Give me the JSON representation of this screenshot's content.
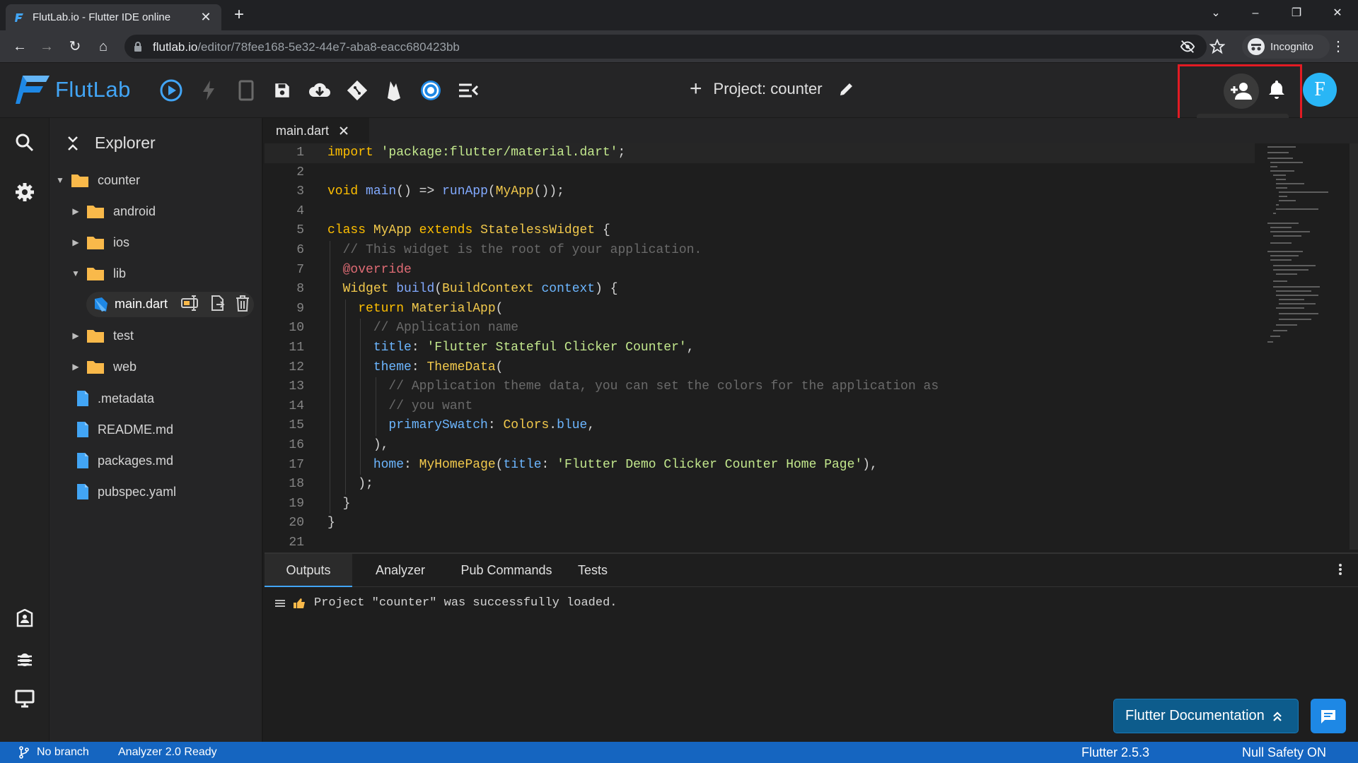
{
  "browser": {
    "tab_title": "FlutLab.io - Flutter IDE online",
    "url_host": "flutlab.io",
    "url_path": "/editor/78fee168-5e32-44e7-aba8-eacc680423bb",
    "profile_label": "Incognito"
  },
  "toolbar": {
    "brand": "FlutLab",
    "project_label": "Project: counter",
    "share_tooltip": "Share Project",
    "avatar_letter": "F"
  },
  "explorer": {
    "title": "Explorer",
    "items": [
      {
        "label": "counter",
        "type": "folder",
        "expanded": true,
        "depth": 0
      },
      {
        "label": "android",
        "type": "folder",
        "expanded": false,
        "depth": 1
      },
      {
        "label": "ios",
        "type": "folder",
        "expanded": false,
        "depth": 1
      },
      {
        "label": "lib",
        "type": "folder",
        "expanded": true,
        "depth": 1
      },
      {
        "label": "main.dart",
        "type": "dart",
        "selected": true,
        "depth": 2
      },
      {
        "label": "test",
        "type": "folder",
        "expanded": false,
        "depth": 1
      },
      {
        "label": "web",
        "type": "folder",
        "expanded": false,
        "depth": 1
      },
      {
        "label": ".metadata",
        "type": "file",
        "depth": 1
      },
      {
        "label": "README.md",
        "type": "file",
        "depth": 1
      },
      {
        "label": "packages.md",
        "type": "file",
        "depth": 1
      },
      {
        "label": "pubspec.yaml",
        "type": "file",
        "depth": 1
      }
    ]
  },
  "editor": {
    "tab_label": "main.dart",
    "lines": [
      {
        "n": "1",
        "code": "import 'package:flutter/material.dart';"
      },
      {
        "n": "2",
        "code": ""
      },
      {
        "n": "3",
        "code": "void main() => runApp(MyApp());"
      },
      {
        "n": "4",
        "code": ""
      },
      {
        "n": "5",
        "code": "class MyApp extends StatelessWidget {"
      },
      {
        "n": "6",
        "code": "  // This widget is the root of your application."
      },
      {
        "n": "7",
        "code": "  @override"
      },
      {
        "n": "8",
        "code": "  Widget build(BuildContext context) {"
      },
      {
        "n": "9",
        "code": "    return MaterialApp("
      },
      {
        "n": "10",
        "code": "      // Application name"
      },
      {
        "n": "11",
        "code": "      title: 'Flutter Stateful Clicker Counter',"
      },
      {
        "n": "12",
        "code": "      theme: ThemeData("
      },
      {
        "n": "13",
        "code": "        // Application theme data, you can set the colors for the application as"
      },
      {
        "n": "14",
        "code": "        // you want"
      },
      {
        "n": "15",
        "code": "        primarySwatch: Colors.blue,"
      },
      {
        "n": "16",
        "code": "      ),"
      },
      {
        "n": "17",
        "code": "      home: MyHomePage(title: 'Flutter Demo Clicker Counter Home Page'),"
      },
      {
        "n": "18",
        "code": "    );"
      },
      {
        "n": "19",
        "code": "  }"
      },
      {
        "n": "20",
        "code": "}"
      },
      {
        "n": "21",
        "code": ""
      }
    ]
  },
  "panel": {
    "tabs": [
      "Outputs",
      "Analyzer",
      "Pub Commands",
      "Tests"
    ],
    "active_tab": "Outputs",
    "output_message": "Project \"counter\" was successfully loaded."
  },
  "floating": {
    "docs_label": "Flutter Documentation"
  },
  "statusbar": {
    "branch": "No branch",
    "analyzer": "Analyzer 2.0 Ready",
    "flutter_version": "Flutter 2.5.3",
    "null_safety": "Null Safety ON"
  },
  "colors": {
    "accent": "#42a5f5",
    "statusbar": "#1565c0",
    "highlight_box": "#e31b23",
    "folder": "#f9b94a",
    "file": "#42a5f5"
  }
}
